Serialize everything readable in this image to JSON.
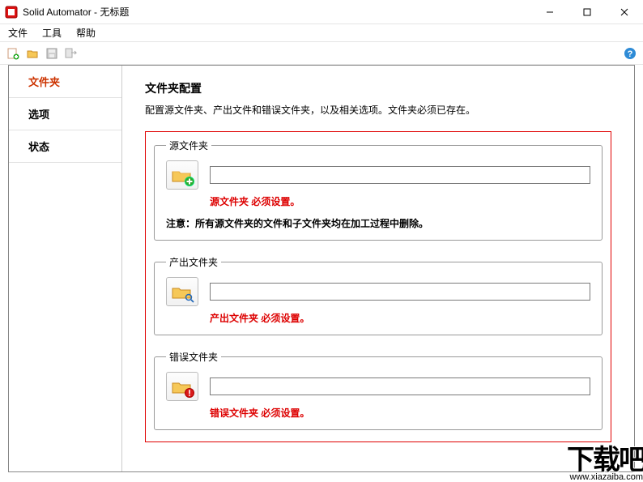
{
  "titlebar": {
    "app_name": "Solid Automator",
    "sep": " - ",
    "doc": "无标题"
  },
  "menubar": {
    "file": "文件",
    "tools": "工具",
    "help": "帮助"
  },
  "sidebar": {
    "items": [
      {
        "label": "文件夹"
      },
      {
        "label": "选项"
      },
      {
        "label": "状态"
      }
    ]
  },
  "main": {
    "title": "文件夹配置",
    "subtitle": "配置源文件夹、产出文件和错误文件夹，以及相关选项。文件夹必须已存在。",
    "source": {
      "legend": "源文件夹",
      "value": "",
      "error": "源文件夹 必须设置。",
      "note": "注意：所有源文件夹的文件和子文件夹均在加工过程中删除。"
    },
    "output": {
      "legend": "产出文件夹",
      "value": "",
      "error": "产出文件夹 必须设置。"
    },
    "errorf": {
      "legend": "错误文件夹",
      "value": "",
      "error": "错误文件夹 必须设置。"
    }
  },
  "watermark": {
    "big": "下载吧",
    "url": "www.xiazaiba.com"
  }
}
